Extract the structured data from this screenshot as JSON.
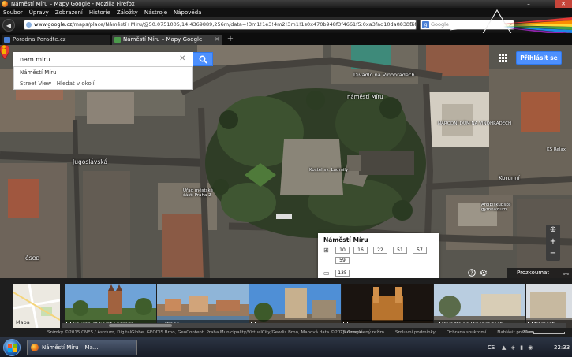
{
  "window": {
    "title": "Náměstí Míru – Mapy Google - Mozilla Firefox",
    "minimize": "–",
    "maximize": "□",
    "close": "✕"
  },
  "menu": [
    "Soubor",
    "Úpravy",
    "Zobrazení",
    "Historie",
    "Záložky",
    "Nástroje",
    "Nápověda"
  ],
  "nav": {
    "back": "◀",
    "forward": "▶",
    "url_host": "www.google.cz",
    "url_rest": "/maps/place/Náměstí+Míru/@50.0751005,14.4369889,256m/data=!3m1!1e3!4m2!3m1!1s0x470b948f3f4661f5:0xa3fad10da0033f6f!5",
    "url_icons": "☆ ▾ C",
    "search_engine": "g",
    "search_placeholder": "Google",
    "search_icon": "⌕"
  },
  "tabs": [
    {
      "label": "Poradna Poradte.cz",
      "close": ""
    },
    {
      "label": "Náměstí Míru – Mapy Google",
      "close": "✕"
    }
  ],
  "new_tab": "+",
  "search": {
    "value": "nam.miru",
    "clear": "✕"
  },
  "suggestions": {
    "first": "Náměstí Míru",
    "sv_label": "Street View",
    "sv_action": "Hledat v okolí"
  },
  "signin": "Přihlásit se",
  "map_labels": {
    "divadlo": "Divadlo na Vinohradech",
    "namesti_miru": "náměstí Míru",
    "narodni_dum": "NÁRODNÍ DŮM NA VINOHRADECH",
    "jugoslavska": "Jugoslávská",
    "urad": "Úřad městské části Praha 2",
    "korunni": "Korunní",
    "gymnazium": "Arcibiskupské gymnázium",
    "csob": "ČSOB",
    "ksrelax": "KS Relax",
    "kostel": "Kostel sv. Ludmily"
  },
  "transit": {
    "title": "Náměstí Míru",
    "tram_lines": [
      "10",
      "16",
      "22",
      "51",
      "57",
      "59"
    ],
    "bus_lines": [
      "135"
    ]
  },
  "controls": {
    "zoom_in": "+",
    "zoom_out": "−",
    "explore": "Prozkoumat",
    "explore_chevron": "︽"
  },
  "strip": {
    "minimap_label": "Mapa",
    "photos": [
      {
        "caption": "Church of Saint Ludmila"
      },
      {
        "caption": "Praha"
      },
      {
        "caption": ""
      },
      {
        "caption": ""
      },
      {
        "caption": "Divadlo na Vinohradech"
      },
      {
        "caption": "Náměstí"
      }
    ]
  },
  "footer": {
    "copyright": "Snímky ©2015 CNES / Astrium, DigitalGlobe, GEODIS Brno, GeoContent, Praha Municipality/VirtualCity/Geodis Brno, Mapová data ©2015 Google",
    "links": [
      "Zjednodušený režim",
      "Smluvní podmínky",
      "Ochrana soukromí",
      "Nahlásit problém"
    ],
    "scale": "20 m"
  },
  "taskbar": {
    "task": "Náměstí Míru – Ma...",
    "lang": "CS",
    "tray_icons": "▲ ◈ ▮ ◉",
    "clock": "22:33"
  },
  "colors": {
    "accent": "#4d90fe",
    "pin": "#e53935"
  }
}
